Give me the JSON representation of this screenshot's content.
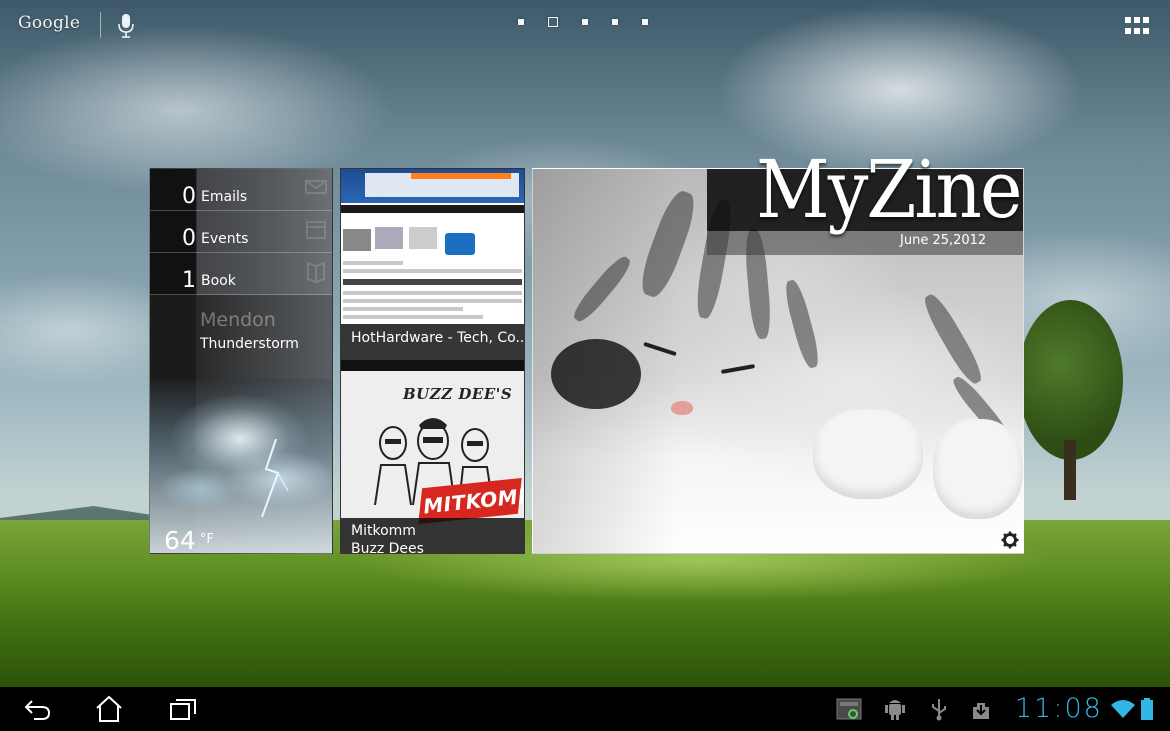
{
  "search_bar": {
    "google_label": "Google",
    "mic_icon": "microphone-icon"
  },
  "home_screens": {
    "count": 5,
    "current_index": 1
  },
  "apps_button": {
    "icon": "all-apps-grid-icon"
  },
  "info_widget": {
    "counts": [
      {
        "value": "0",
        "label": "Emails",
        "icon": "mail-icon"
      },
      {
        "value": "0",
        "label": "Events",
        "icon": "calendar-icon"
      },
      {
        "value": "1",
        "label": "Book",
        "icon": "book-icon"
      }
    ],
    "weather": {
      "city": "Mendon",
      "condition": "Thunderstorm",
      "temperature": "64",
      "unit": "°F",
      "icon": "thunderstorm-icon"
    }
  },
  "news_widget": {
    "items": [
      {
        "title": "HotHardware - Tech, Co..."
      },
      {
        "title_line1": "Mitkomm",
        "title_line2": "Buzz Dees",
        "comic_heading": "BUZZ DEE'S",
        "comic_burst": "MITKOMM!"
      }
    ]
  },
  "myzine_widget": {
    "title": "MyZine",
    "date": "June 25,2012",
    "settings_icon": "gear-icon"
  },
  "system_bar": {
    "nav": [
      "back-icon",
      "home-icon",
      "recent-apps-icon"
    ],
    "status_icons": [
      "screenshot-icon",
      "android-debug-icon",
      "usb-icon",
      "download-icon"
    ],
    "clock": "11:08",
    "wifi_icon": "wifi-icon",
    "battery_icon": "battery-icon",
    "accent_color": "#33b5e5"
  }
}
